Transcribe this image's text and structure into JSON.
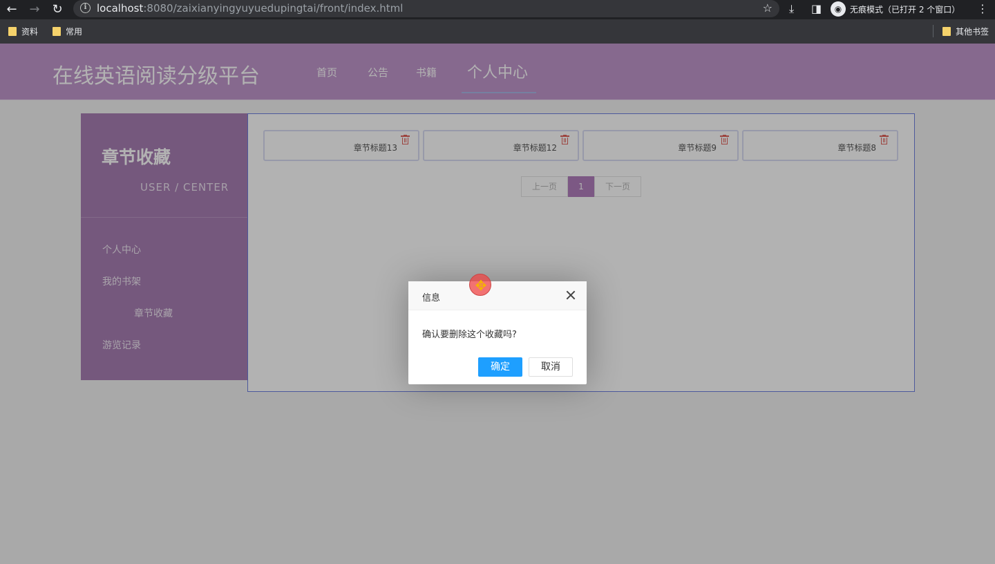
{
  "browser": {
    "url_host": "localhost",
    "url_path": ":8080/zaixianyingyuyuedupingtai/front/index.html",
    "incognito_label": "无痕模式（已打开 2 个窗口）",
    "bookmarks": [
      "资料",
      "常用"
    ],
    "other_bookmarks": "其他书签"
  },
  "header": {
    "site_title": "在线英语阅读分级平台",
    "nav": [
      "首页",
      "公告",
      "书籍",
      "个人中心"
    ]
  },
  "sidebar": {
    "title": "章节收藏",
    "subtitle": "USER / CENTER",
    "items": [
      "个人中心",
      "我的书架",
      "章节收藏",
      "游览记录"
    ]
  },
  "favorites": {
    "cards": [
      "章节标题13",
      "章节标题12",
      "章节标题9",
      "章节标题8"
    ]
  },
  "pagination": {
    "prev": "上一页",
    "current": "1",
    "next": "下一页"
  },
  "dialog": {
    "title": "信息",
    "message": "确认要删除这个收藏吗?",
    "confirm": "确定",
    "cancel": "取消"
  },
  "colors": {
    "header_bg": "#c097cc",
    "sidebar_bg": "#a87fb4",
    "active_page": "#b27fbe",
    "confirm_button": "#1e9fff",
    "delete_icon": "#e0605a"
  }
}
